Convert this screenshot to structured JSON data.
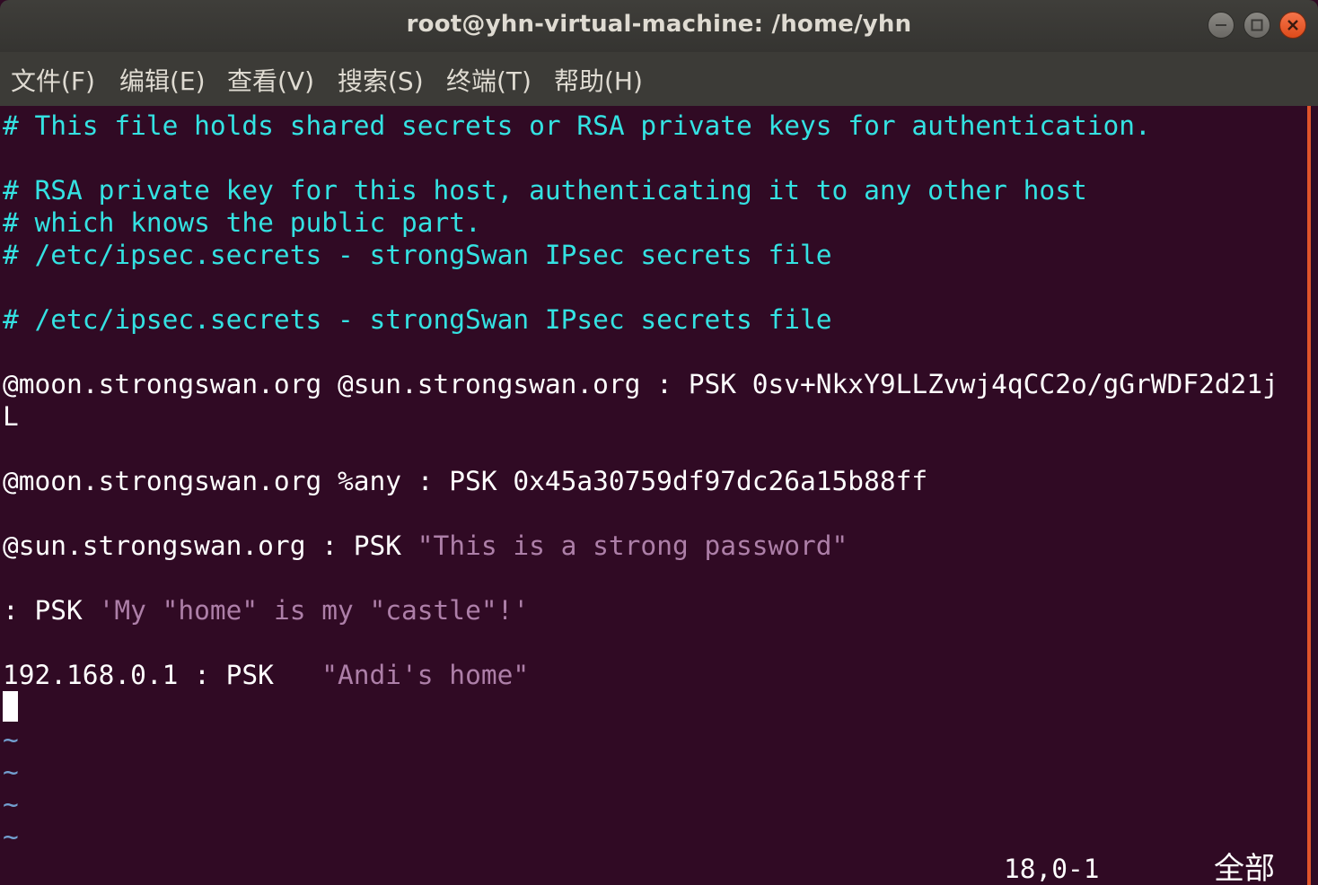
{
  "window": {
    "title": "root@yhn-virtual-machine: /home/yhn"
  },
  "menu": [
    {
      "label": "文件(F)"
    },
    {
      "label": "编辑(E)"
    },
    {
      "label": "查看(V)"
    },
    {
      "label": "搜索(S)"
    },
    {
      "label": "终端(T)"
    },
    {
      "label": "帮助(H)"
    }
  ],
  "editor": {
    "lines": [
      {
        "type": "comment",
        "text": "# This file holds shared secrets or RSA private keys for authentication."
      },
      {
        "type": "blank",
        "text": ""
      },
      {
        "type": "comment",
        "text": "# RSA private key for this host, authenticating it to any other host"
      },
      {
        "type": "comment",
        "text": "# which knows the public part."
      },
      {
        "type": "comment",
        "text": "# /etc/ipsec.secrets - strongSwan IPsec secrets file"
      },
      {
        "type": "blank",
        "text": ""
      },
      {
        "type": "comment",
        "text": "# /etc/ipsec.secrets - strongSwan IPsec secrets file"
      },
      {
        "type": "blank",
        "text": ""
      },
      {
        "type": "plain",
        "text": "@moon.strongswan.org @sun.strongswan.org : PSK 0sv+NkxY9LLZvwj4qCC2o/gGrWDF2d21j"
      },
      {
        "type": "plain",
        "text": "L"
      },
      {
        "type": "blank",
        "text": ""
      },
      {
        "type": "plain",
        "text": "@moon.strongswan.org %any : PSK 0x45a30759df97dc26a15b88ff"
      },
      {
        "type": "blank",
        "text": ""
      },
      {
        "type": "mixed",
        "plain": "@sun.strongswan.org : PSK ",
        "string": "\"This is a strong password\""
      },
      {
        "type": "blank",
        "text": ""
      },
      {
        "type": "mixed",
        "plain": ": PSK ",
        "string": "'My \"home\" is my \"castle\"!'"
      },
      {
        "type": "blank",
        "text": ""
      },
      {
        "type": "mixed",
        "plain": "192.168.0.1 : PSK   ",
        "string": "\"Andi's home\""
      }
    ],
    "empty_line_marker": "~",
    "status_position": "18,0-1",
    "status_scroll": "全部"
  },
  "colors": {
    "background": "#300a24",
    "comment": "#34e2e2",
    "string": "#ad7fa8",
    "tilde": "#729fcf",
    "close_button": "#e95420"
  }
}
